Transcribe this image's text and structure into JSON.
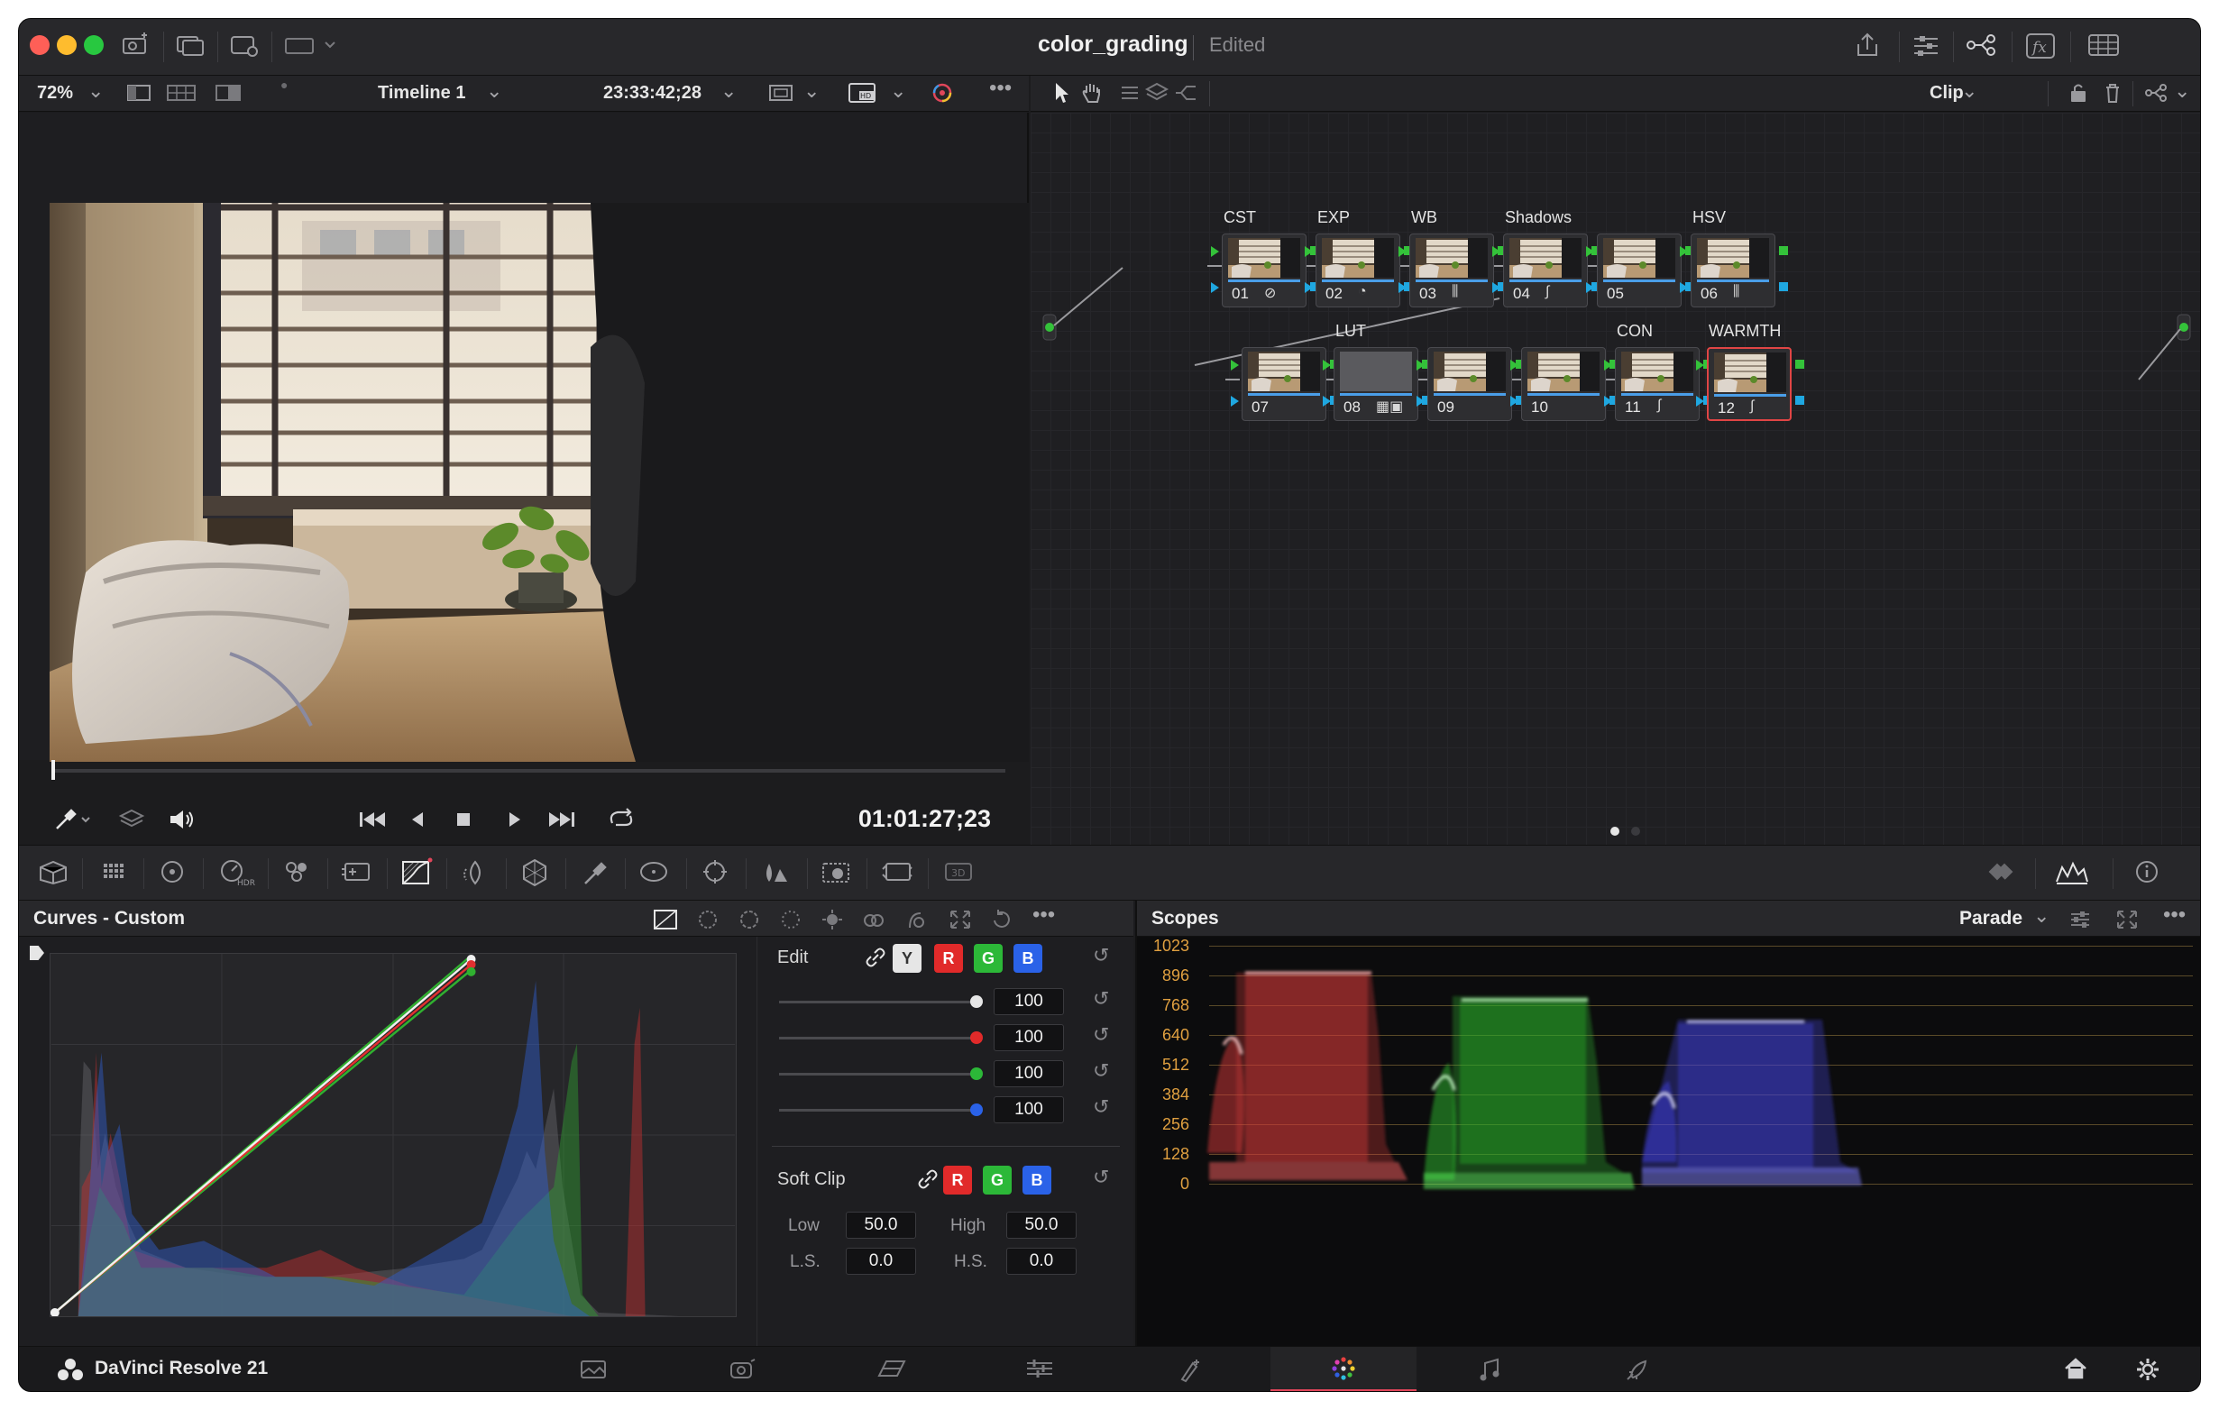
{
  "window": {
    "title": "color_grading",
    "status": "Edited"
  },
  "viewer": {
    "zoom": "72%",
    "timeline": "Timeline 1",
    "source_timecode": "23:33:42;28",
    "record_timecode": "01:01:27;23"
  },
  "node_editor": {
    "mode": "Clip",
    "nodes": [
      {
        "num": "01",
        "label": "CST"
      },
      {
        "num": "02",
        "label": "EXP"
      },
      {
        "num": "03",
        "label": "WB"
      },
      {
        "num": "04",
        "label": "Shadows"
      },
      {
        "num": "05",
        "label": ""
      },
      {
        "num": "06",
        "label": "HSV"
      },
      {
        "num": "07",
        "label": ""
      },
      {
        "num": "08",
        "label": "LUT"
      },
      {
        "num": "09",
        "label": ""
      },
      {
        "num": "10",
        "label": ""
      },
      {
        "num": "11",
        "label": "CON"
      },
      {
        "num": "12",
        "label": "WARMTH"
      }
    ]
  },
  "curves": {
    "title": "Curves - Custom",
    "edit_label": "Edit",
    "channels": {
      "y": "Y",
      "r": "R",
      "g": "G",
      "b": "B"
    },
    "intensity": {
      "y": "100",
      "r": "100",
      "g": "100",
      "b": "100"
    },
    "soft_clip": {
      "label": "Soft Clip",
      "low_label": "Low",
      "low": "50.0",
      "high_label": "High",
      "high": "50.0",
      "ls_label": "L.S.",
      "ls": "0.0",
      "hs_label": "H.S.",
      "hs": "0.0"
    }
  },
  "scopes": {
    "title": "Scopes",
    "mode": "Parade",
    "ticks": [
      "1023",
      "896",
      "768",
      "640",
      "512",
      "384",
      "256",
      "128",
      "0"
    ]
  },
  "footer": {
    "app_name": "DaVinci Resolve 21"
  },
  "colors": {
    "accent": "#e0465a",
    "node_port_green": "#34c23a",
    "node_port_blue": "#1fa7e0",
    "scope_tick": "#e0a040"
  }
}
